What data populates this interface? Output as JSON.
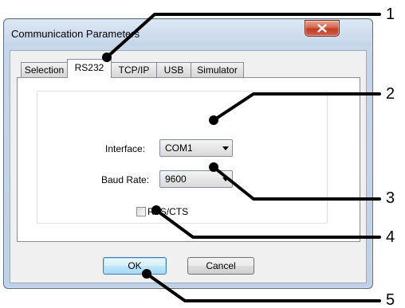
{
  "window": {
    "title": "Communication Parameters"
  },
  "tabs": [
    {
      "label": "Selection"
    },
    {
      "label": "RS232",
      "active": true
    },
    {
      "label": "TCP/IP"
    },
    {
      "label": "USB"
    },
    {
      "label": "Simulator"
    }
  ],
  "rs232": {
    "interface_label": "Interface:",
    "interface_value": "COM1",
    "baud_label": "Baud Rate:",
    "baud_value": "9600",
    "rts_label": "RTS/CTS",
    "rts_checked": false
  },
  "buttons": {
    "ok": "OK",
    "cancel": "Cancel"
  },
  "callouts": [
    "1",
    "2",
    "3",
    "4",
    "5"
  ],
  "colors": {
    "close_button": "#c23b22",
    "default_button_border": "#3c7fb1"
  },
  "icons": {
    "close": "close-icon",
    "dropdown": "chevron-down-icon"
  }
}
